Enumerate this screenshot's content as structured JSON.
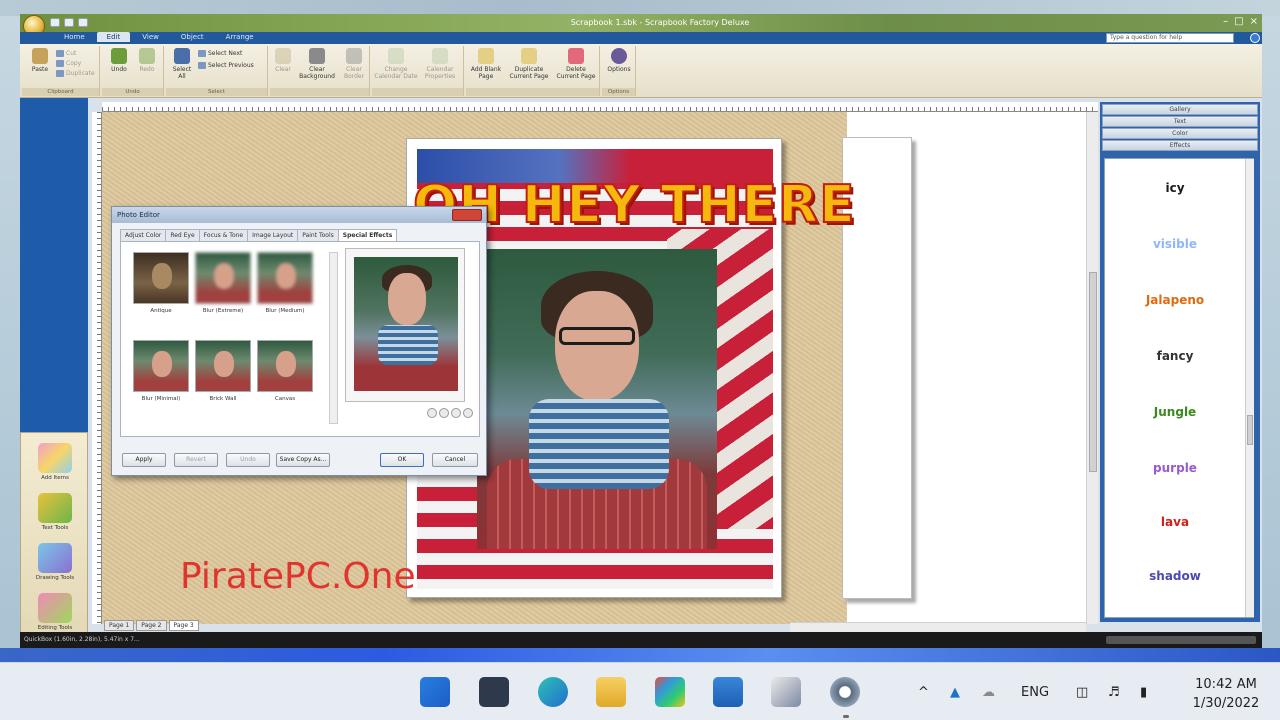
{
  "window": {
    "title": "Scrapbook 1.sbk - Scrapbook Factory Deluxe",
    "minimize": "–",
    "maximize": "□",
    "close": "×"
  },
  "ribbon": {
    "tabs": [
      "Home",
      "Edit",
      "View",
      "Object",
      "Arrange"
    ],
    "active_tab": "Edit",
    "help_placeholder": "Type a question for help",
    "clipboard": {
      "paste": "Paste",
      "cut": "Cut",
      "copy": "Copy",
      "duplicate": "Duplicate",
      "label": "Clipboard"
    },
    "undo_group": {
      "undo": "Undo",
      "redo": "Redo",
      "label": "Undo"
    },
    "select_group": {
      "select_all": "Select All",
      "select_next": "Select Next",
      "select_previous": "Select Previous",
      "label": "Select"
    },
    "clear": "Clear",
    "clear_background": "Clear Background",
    "clear_border": "Clear Border",
    "change_calendar_date": "Change Calendar Date",
    "calendar_properties": "Calendar Properties",
    "add_blank_page": "Add Blank Page",
    "duplicate_current_page": "Duplicate Current Page",
    "delete_current_page": "Delete Current Page",
    "options": "Options",
    "options_label": "Options"
  },
  "left_tools": {
    "add_items": "Add Items",
    "text_tools": "Text Tools",
    "drawing_tools": "Drawing Tools",
    "editing_tools": "Editing Tools"
  },
  "canvas": {
    "headline": "OH HEY THERE",
    "page_tabs": [
      "Page 1",
      "Page 2",
      "Page 3"
    ],
    "active_page": "Page 3"
  },
  "watermark": "PiratePC.One",
  "right_panel": {
    "sections": [
      "Gallery",
      "Text",
      "Color",
      "Effects"
    ],
    "styles": [
      {
        "label": "icy",
        "color": "#1a1a1a"
      },
      {
        "label": "visible",
        "color": "#8fb6ff"
      },
      {
        "label": "Jalapeno",
        "color": "#e06a10"
      },
      {
        "label": "fancy",
        "color": "#333333"
      },
      {
        "label": "Jungle",
        "color": "#3b8a1e"
      },
      {
        "label": "purple",
        "color": "#9b59d0"
      },
      {
        "label": "lava",
        "color": "#d0201a"
      },
      {
        "label": "shadow",
        "color": "#4a4ab0"
      }
    ]
  },
  "statusbar": {
    "text": "QuickBox (1.60in, 2.28in), 5.47in x 7..."
  },
  "photo_editor": {
    "title": "Photo Editor",
    "tabs": [
      "Adjust Color",
      "Red Eye",
      "Focus & Tone",
      "Image Layout",
      "Paint Tools",
      "Special Effects"
    ],
    "active_tab": "Special Effects",
    "effects": [
      "Antique",
      "Blur (Extreme)",
      "Blur (Medium)",
      "Blur (Minimal)",
      "Brick Wall",
      "Canvas"
    ],
    "buttons": {
      "apply": "Apply",
      "revert": "Revert",
      "undo": "Undo",
      "save_copy": "Save Copy As...",
      "ok": "OK",
      "cancel": "Cancel"
    }
  },
  "taskbar": {
    "language": "ENG",
    "time": "10:42 AM",
    "date": "1/30/2022"
  }
}
